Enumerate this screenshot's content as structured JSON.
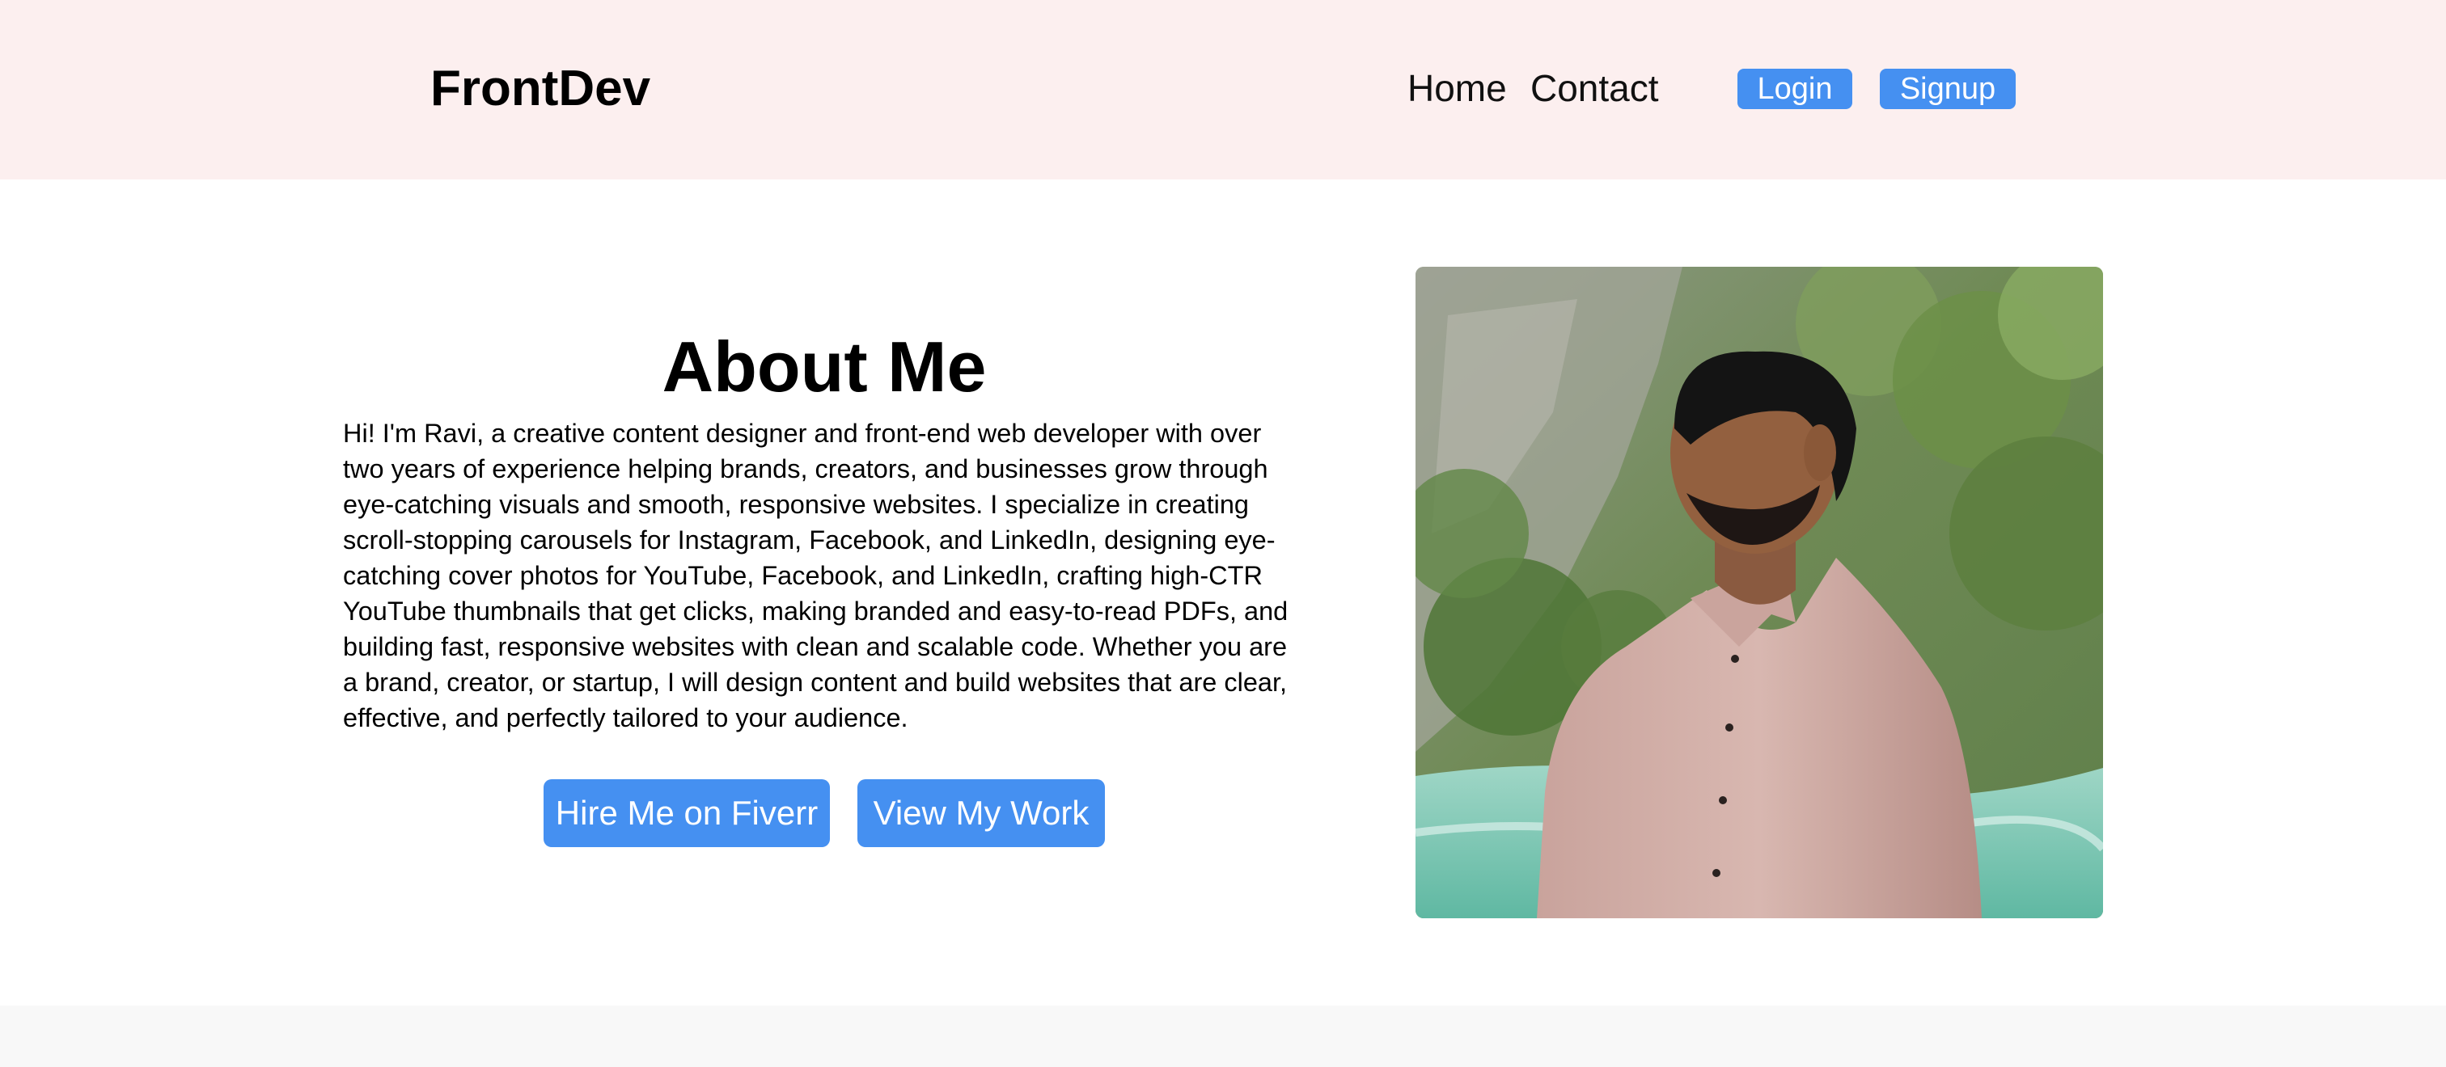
{
  "header": {
    "logo": "FrontDev",
    "nav": {
      "home": "Home",
      "contact": "Contact"
    },
    "login_label": "Login",
    "signup_label": "Signup"
  },
  "about": {
    "title": "About Me",
    "description": "Hi! I'm Ravi, a creative content designer and front-end web developer with over two years of experience helping brands, creators, and businesses grow through eye-catching visuals and smooth, responsive websites. I specialize in creating scroll-stopping carousels for Instagram, Facebook, and LinkedIn, designing eye-catching cover photos for YouTube, Facebook, and LinkedIn, crafting high-CTR YouTube thumbnails that get clicks, making branded and easy-to-read PDFs, and building fast, responsive websites with clean and scalable code. Whether you are a brand, creator, or startup, I will design content and build websites that are clear, effective, and perfectly tailored to your audience.",
    "hire_button": "Hire Me on Fiverr",
    "work_button": "View My Work"
  },
  "colors": {
    "header_bg": "#fcefef",
    "accent": "#4590f1",
    "footer_bg": "#f8f8f8"
  }
}
